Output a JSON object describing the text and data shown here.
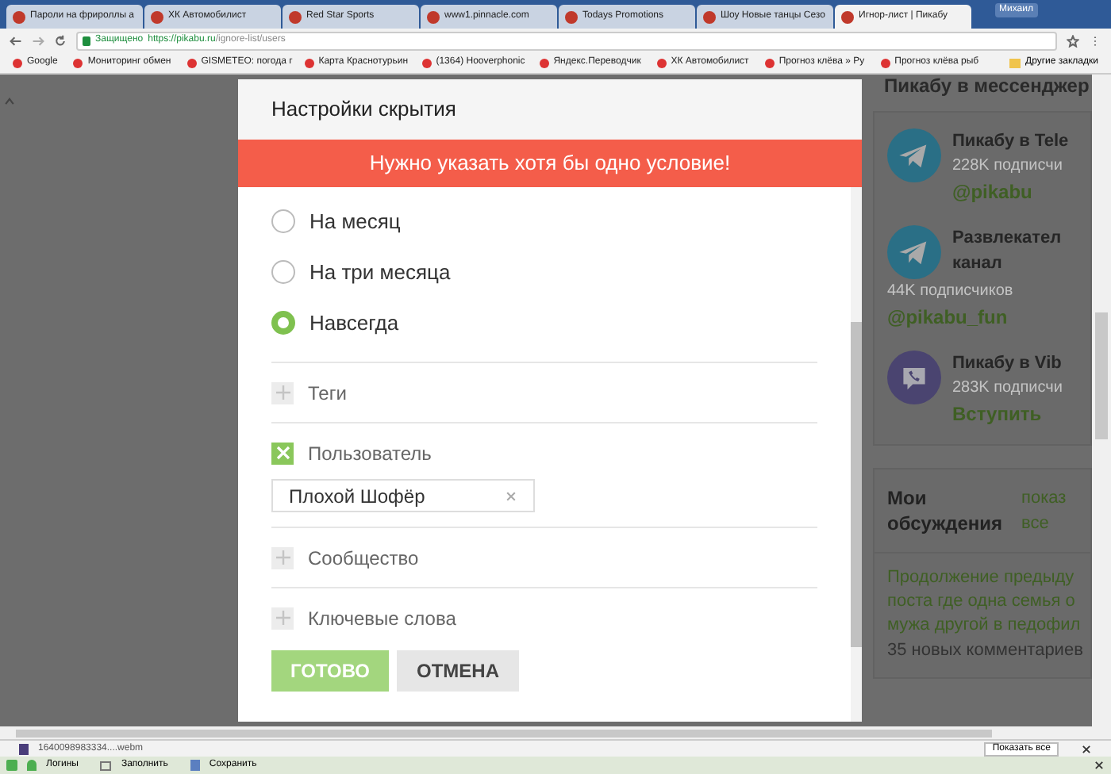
{
  "browser": {
    "user": "Михаил",
    "tabs": [
      {
        "title": "Пароли на фрироллы а",
        "selected": false
      },
      {
        "title": "ХК Автомобилист",
        "selected": false
      },
      {
        "title": "Red Star Sports",
        "selected": false
      },
      {
        "title": "www1.pinnacle.com",
        "selected": false
      },
      {
        "title": "Todays Promotions",
        "selected": false
      },
      {
        "title": "Шоу Новые танцы Сезо",
        "selected": false
      },
      {
        "title": "Игнор-лист | Пикабу",
        "selected": true
      }
    ],
    "secure_label": "Защищено",
    "url_host": "https://pikabu.ru",
    "url_path": "/ignore-list/users",
    "bookmarks": [
      "Google",
      "Мониторинг обмен",
      "GISMETEO: погода г",
      "Карта Краснотурьин",
      "(1364) Hooverphonic",
      "Яндекс.Переводчик",
      "ХК Автомобилист",
      "Прогноз клёва » Ру",
      "Прогноз клёва рыб"
    ],
    "other_bookmarks": "Другие закладки"
  },
  "dialog": {
    "title": "Настройки скрытия",
    "error": "Нужно указать хотя бы одно условие!",
    "periods": [
      {
        "label": "На месяц",
        "selected": false
      },
      {
        "label": "На три месяца",
        "selected": false
      },
      {
        "label": "Навсегда",
        "selected": true
      }
    ],
    "conditions": [
      {
        "label": "Теги",
        "checked": false
      },
      {
        "label": "Пользователь",
        "checked": true,
        "value": "Плохой Шофёр"
      },
      {
        "label": "Сообщество",
        "checked": false
      },
      {
        "label": "Ключевые слова",
        "checked": false
      }
    ],
    "ok": "ГОТОВО",
    "cancel": "ОТМЕНА"
  },
  "sidebar": {
    "heading": "Пикабу в мессенджер",
    "channels": [
      {
        "kind": "telegram",
        "name": "Пикабу в Tele",
        "subscribers": "228K подписчи",
        "link": "@pikabu"
      },
      {
        "kind": "telegram",
        "name": "Развлекател канал",
        "subscribers": "44K подписчиков",
        "link": "@pikabu_fun"
      },
      {
        "kind": "viber",
        "name": "Пикабу в Vib",
        "subscribers": "283K подписчи",
        "link": "Вступить"
      }
    ],
    "discussions_title": "Мои обсуждения",
    "show_all": "показ все",
    "post": "Продолжение предыду поста где одна семья о мужа другой в педофил",
    "comments": "35 новых комментариев"
  },
  "downloads": {
    "file": "1640098983334....webm",
    "show_all": "Показать все"
  },
  "toolbar": {
    "logins": "Логины",
    "fill": "Заполнить",
    "save": "Сохранить"
  }
}
